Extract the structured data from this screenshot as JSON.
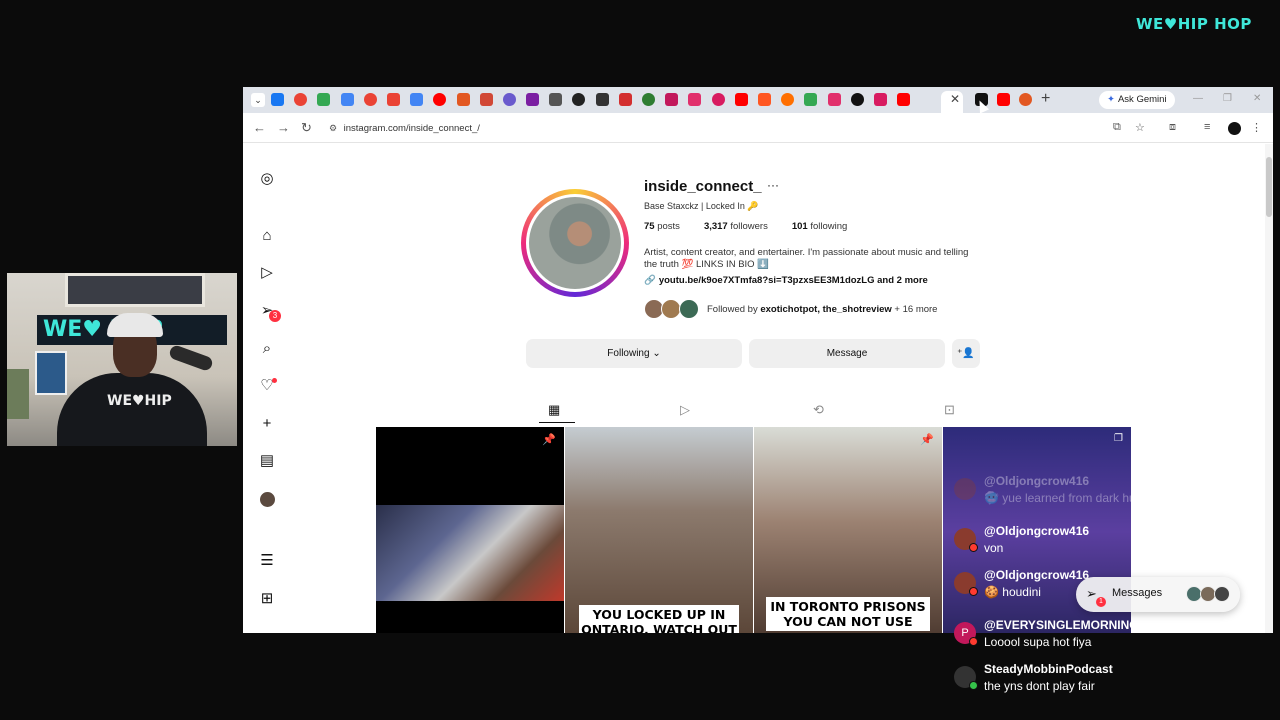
{
  "brand": {
    "text": "WE♥HIP HOP"
  },
  "webcam": {
    "shirt_text": "WE♥HIP",
    "sign_text": "WE♥  HOP"
  },
  "browser": {
    "gemini_label": "Ask Gemini",
    "url": "instagram.com/inside_connect_/",
    "favicon_colors": [
      "#1877f2",
      "#ea4335",
      "#34a853",
      "#4285f4",
      "#ea4335",
      "#ea4335",
      "#4285f4",
      "#ff0000",
      "#e25822",
      "#d14836",
      "#6a5acd",
      "#7b1fa2",
      "#555555",
      "#222222",
      "#333333",
      "#d32f2f",
      "#2e7d32",
      "#c2185b",
      "#e1306c",
      "#d81b60",
      "#ff0000",
      "#ff5722",
      "#ff6f00",
      "#34a853",
      "#e1306c",
      "#111111",
      "#d81b60",
      "#ff0000"
    ]
  },
  "profile": {
    "username": "inside_connect_",
    "subtitle": "Base Staxckz | Locked In 🔑",
    "posts_count": "75",
    "posts_label": "posts",
    "followers_count": "3,317",
    "followers_label": "followers",
    "following_count": "101",
    "following_label": "following",
    "bio": "Artist, content creator, and entertainer. I'm passionate about music and telling the truth 💯 LINKS IN BIO ⬇️",
    "link": "youtu.be/k9oe7XTmfa8?si=T3pzxsEE3M1dozLG and 2 more",
    "followed_by_prefix": "Followed by",
    "followed_by_names": "exotichotpot, the_shotreview",
    "followed_by_more": "+ 16 more",
    "following_button": "Following ⌄",
    "message_button": "Message",
    "notif_badge": "3"
  },
  "posts": [
    {
      "caption": ""
    },
    {
      "caption": "YOU LOCKED UP IN ONTARIO, WATCH OUT"
    },
    {
      "caption": "IN TORONTO PRISONS YOU CAN NOT USE"
    },
    {
      "caption": ""
    }
  ],
  "chat": [
    {
      "user": "@Oldjongcrow416",
      "message": "🥶 yue learned from dark hun Freddy"
    },
    {
      "user": "@Oldjongcrow416",
      "message": "von"
    },
    {
      "user": "@Oldjongcrow416",
      "message": "🍪 houdini"
    },
    {
      "user": "@EVERYSINGLEMORNING",
      "message": "Looool supa hot fiya",
      "avatar_letter": "P"
    },
    {
      "user": "SteadyMobbinPodcast",
      "message": "the yns dont play fair"
    }
  ],
  "messages_pill": {
    "label": "Messages",
    "badge": "1"
  }
}
